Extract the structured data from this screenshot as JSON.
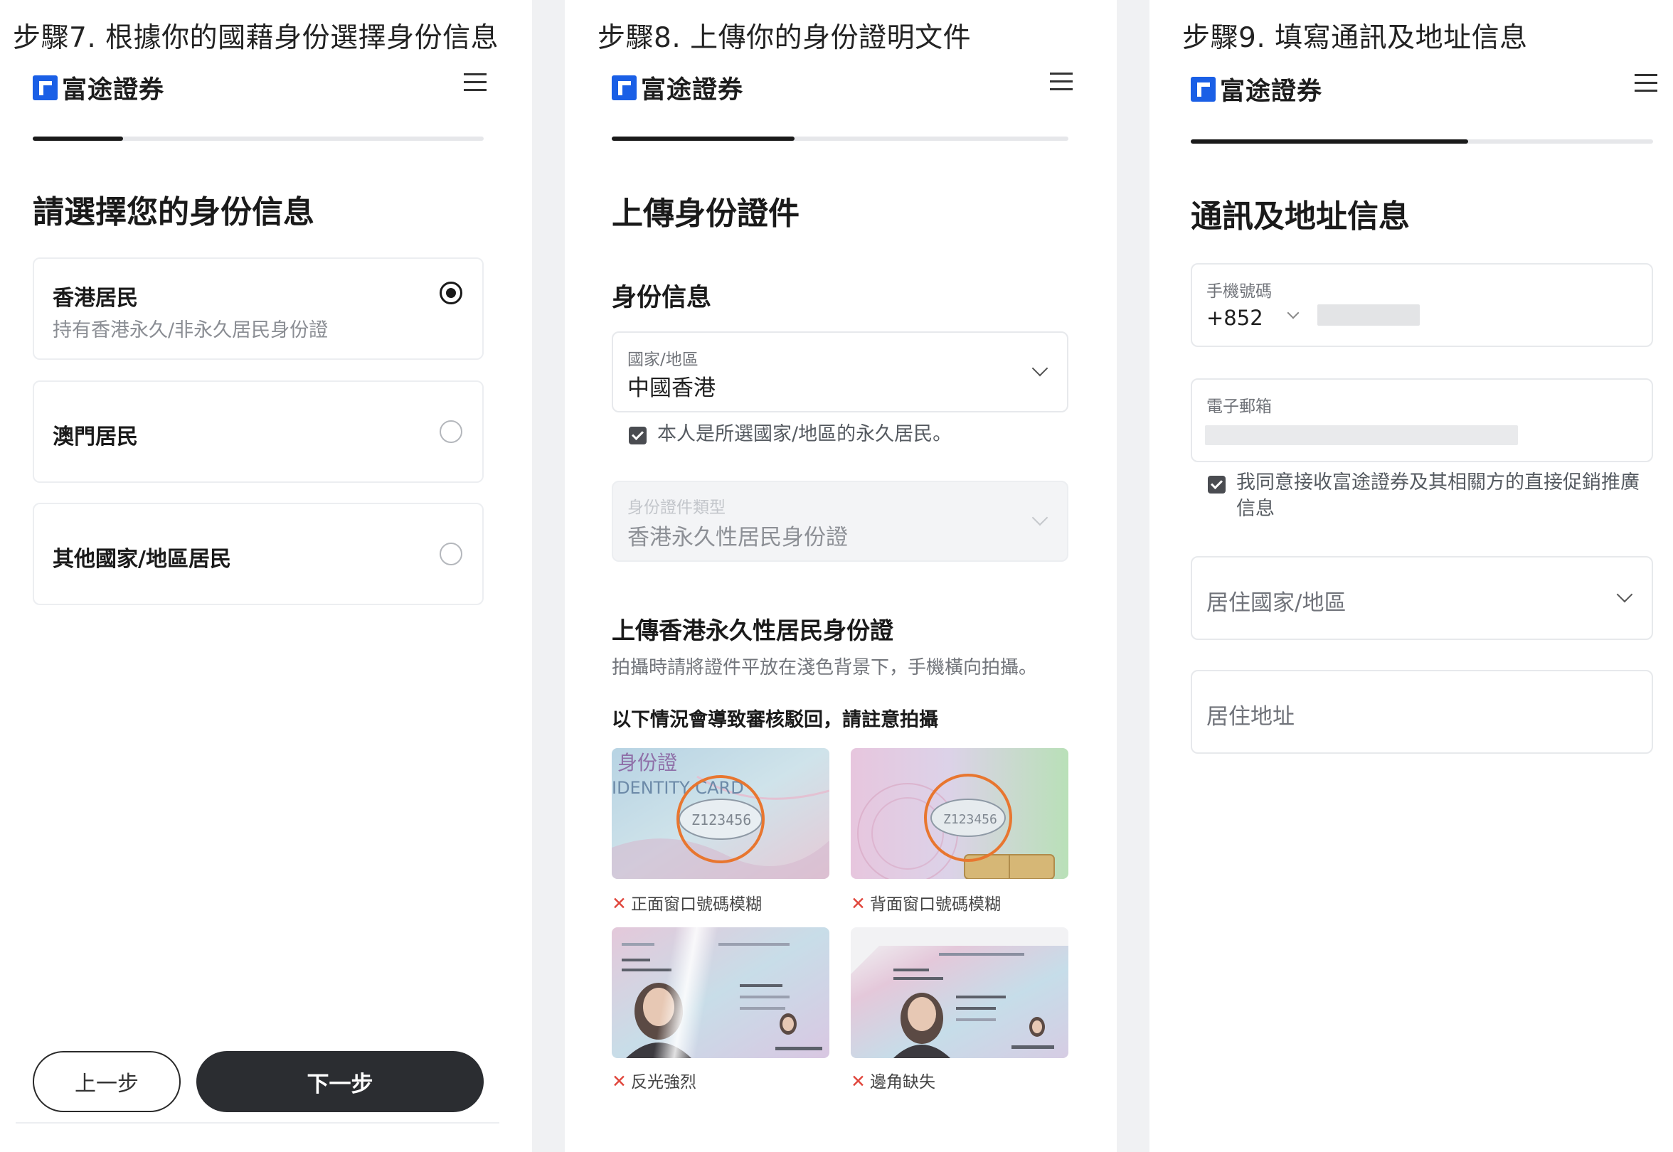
{
  "captions": [
    "步驟7. 根據你的國藉身份選擇身份信息",
    "步驟8. 上傳你的身份證明文件",
    "步驟9. 填寫通訊及地址信息"
  ],
  "brand": {
    "name": "富途證券",
    "logo_color": "#1a5fe6"
  },
  "progress": [
    0.2,
    0.4,
    0.6
  ],
  "panel1": {
    "heading": "請選擇您的身份信息",
    "options": [
      {
        "title": "香港居民",
        "subtitle": "持有香港永久/非永久居民身份證",
        "selected": true
      },
      {
        "title": "澳門居民",
        "selected": false
      },
      {
        "title": "其他國家/地區居民",
        "selected": false
      }
    ],
    "prev_label": "上一步",
    "next_label": "下一步"
  },
  "panel2": {
    "heading": "上傳身份證件",
    "section": "身份信息",
    "country_field": {
      "label": "國家/地區",
      "value": "中國香港"
    },
    "permanent_check": "本人是所選國家/地區的永久居民。",
    "doc_type_field": {
      "label": "身份證件類型",
      "value": "香港永久性居民身份證"
    },
    "upload_heading": "上傳香港永久性居民身份證",
    "upload_desc": "拍攝時請將證件平放在淺色背景下，手機橫向拍攝。",
    "warning_heading": "以下情況會導致審核駁回，請註意拍攝",
    "samples": [
      {
        "caption": "正面窗口號碼模糊",
        "card_title": "身份證",
        "card_subtitle": "IDENTITY CARD",
        "number": "Z123456"
      },
      {
        "caption": "背面窗口號碼模糊",
        "number": "Z123456"
      },
      {
        "caption": "反光強烈"
      },
      {
        "caption": "邊角缺失"
      }
    ]
  },
  "panel3": {
    "heading": "通訊及地址信息",
    "phone": {
      "label": "手機號碼",
      "code": "+852"
    },
    "email": {
      "label": "電子郵箱"
    },
    "promo_check": "我同意接收富途證券及其相關方的直接促銷推廣信息",
    "residence_country": {
      "placeholder": "居住國家/地區"
    },
    "address": {
      "placeholder": "居住地址"
    }
  }
}
